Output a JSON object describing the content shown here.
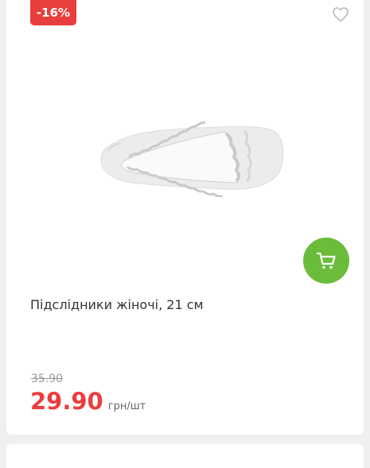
{
  "product": {
    "discount_badge": "-16%",
    "title": "Підслідники жіночі, 21 см",
    "old_price": "35.90",
    "price": "29.90",
    "unit": "грн/шт"
  },
  "icons": {
    "favorite": "heart-outline-icon",
    "cart": "shopping-cart-icon"
  },
  "colors": {
    "discount": "#ea3d3d",
    "cart_button": "#6abc3a",
    "price": "#ea3d3d"
  }
}
